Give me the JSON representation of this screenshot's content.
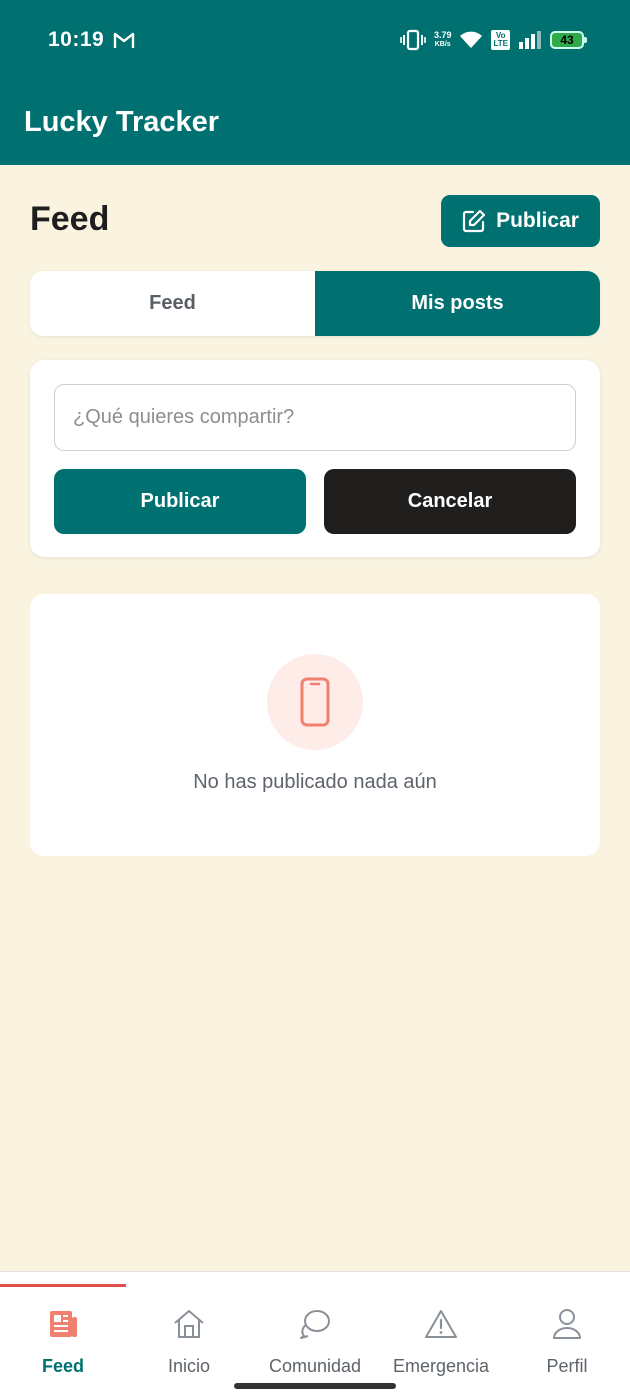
{
  "status_bar": {
    "time": "10:19",
    "speed_value": "3.79",
    "speed_unit": "KB/s",
    "volte_top": "Vo",
    "volte_bottom": "LTE",
    "battery": "43"
  },
  "app_bar": {
    "title": "Lucky Tracker"
  },
  "header": {
    "title": "Feed",
    "publish_label": "Publicar"
  },
  "tabs": [
    {
      "label": "Feed",
      "active": false
    },
    {
      "label": "Mis posts",
      "active": true
    }
  ],
  "composer": {
    "placeholder": "¿Qué quieres compartir?",
    "value": "",
    "publish_label": "Publicar",
    "cancel_label": "Cancelar"
  },
  "empty_state": {
    "icon": "phone-icon",
    "message": "No has publicado nada aún"
  },
  "bottom_nav": [
    {
      "label": "Feed",
      "icon": "newspaper-icon",
      "active": true
    },
    {
      "label": "Inicio",
      "icon": "home-icon",
      "active": false
    },
    {
      "label": "Comunidad",
      "icon": "chat-bubbles-icon",
      "active": false
    },
    {
      "label": "Emergencia",
      "icon": "warning-icon",
      "active": false
    },
    {
      "label": "Perfil",
      "icon": "user-icon",
      "active": false
    }
  ],
  "colors": {
    "primary": "#007070",
    "background": "#F9F3E0",
    "accent": "#E0504A",
    "dark_button": "#1F1E1D"
  }
}
